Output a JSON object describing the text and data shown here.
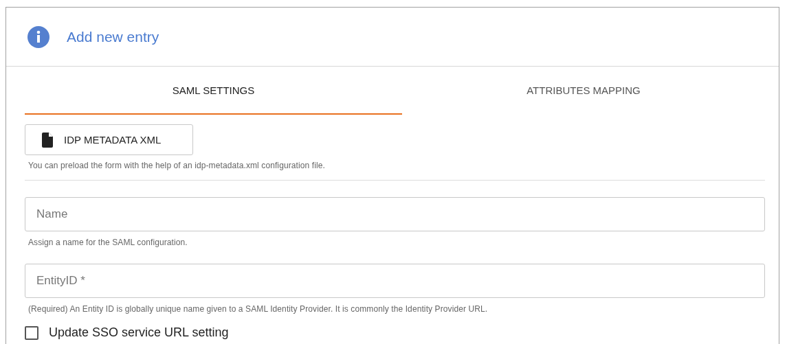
{
  "dialog": {
    "title": "Add new entry"
  },
  "tabs": [
    {
      "label": "SAML SETTINGS",
      "selected": true
    },
    {
      "label": "ATTRIBUTES MAPPING",
      "selected": false
    }
  ],
  "metadata_button": {
    "label": "IDP METADATA XML"
  },
  "metadata_hint": "You can preload the form with the help of an idp-metadata.xml configuration file.",
  "fields": [
    {
      "placeholder": "Name",
      "hint": "Assign a name for the SAML configuration."
    },
    {
      "placeholder": "EntityID *",
      "hint": "(Required) An Entity ID is globally unique name given to a SAML Identity Provider. It is commonly the Identity Provider URL."
    }
  ],
  "checkbox": {
    "label": "Update SSO service URL setting",
    "checked": false
  }
}
